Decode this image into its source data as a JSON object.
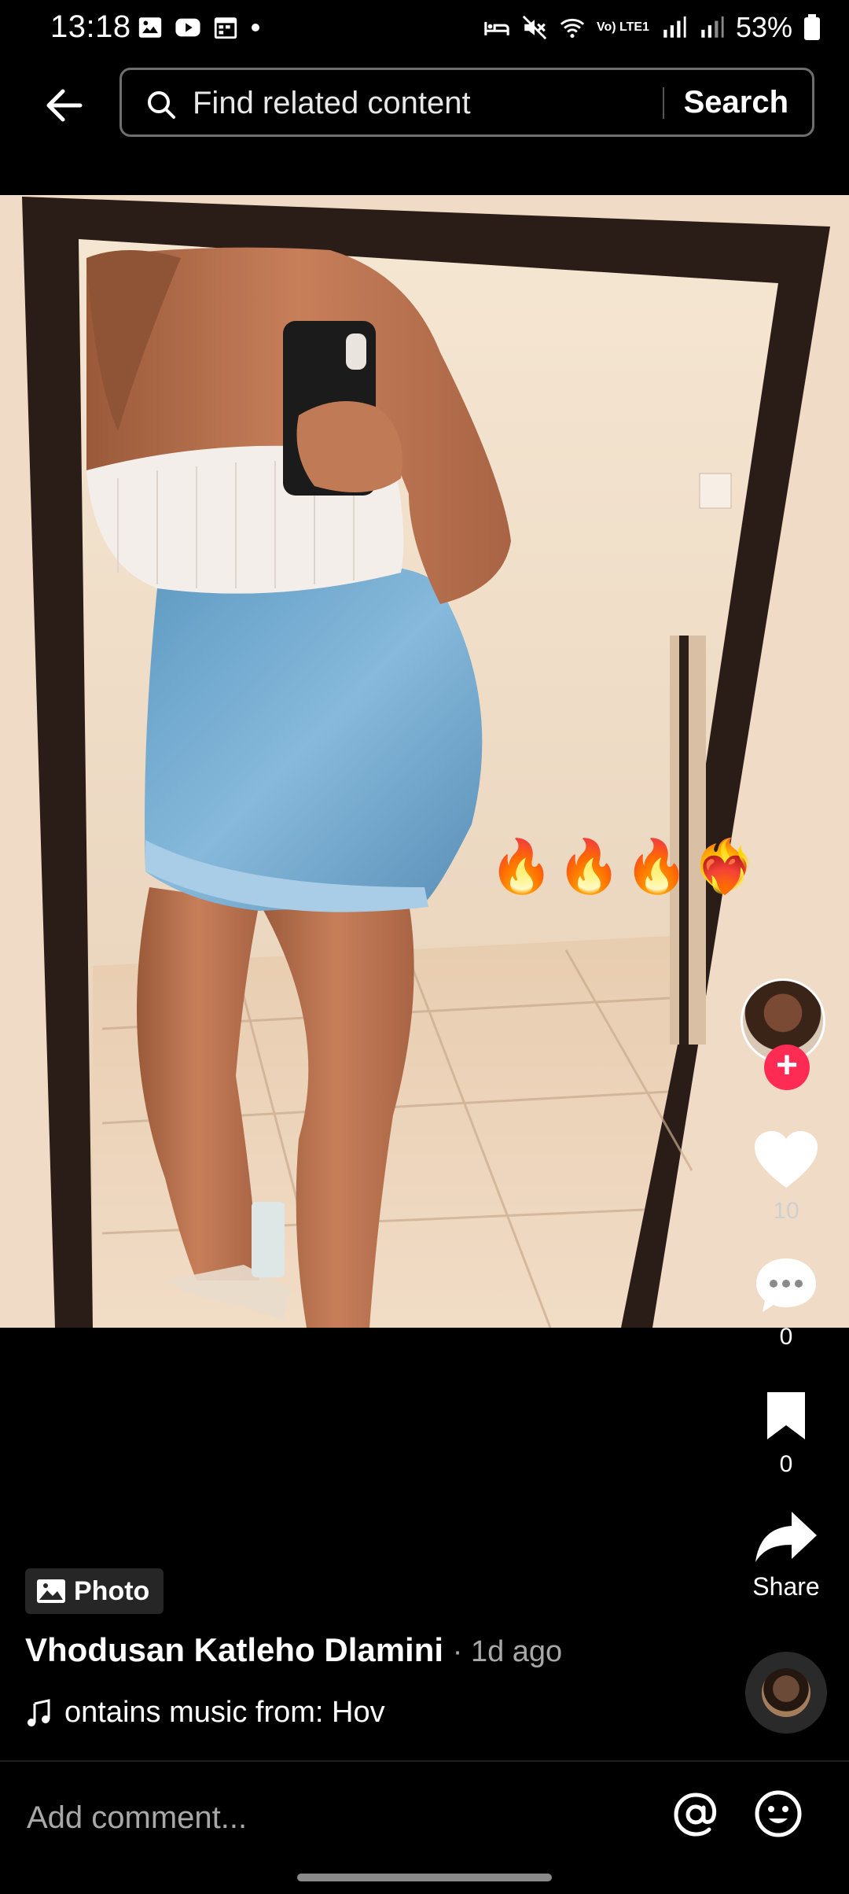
{
  "status_bar": {
    "time": "13:18",
    "battery": "53%",
    "network_label": "Vo) LTE1"
  },
  "search": {
    "placeholder": "Find related content",
    "button_label": "Search"
  },
  "photo": {
    "overlay_emojis": "🔥🔥🔥❤️‍🔥"
  },
  "rail": {
    "like_count": "10",
    "comment_count": "0",
    "bookmark_count": "0",
    "share_label": "Share"
  },
  "post": {
    "badge_label": "Photo",
    "author": "Vhodusan Katleho Dlamini",
    "time": "· 1d ago",
    "music": "ontains music from: Hov"
  },
  "comment": {
    "placeholder": "Add comment..."
  },
  "colors": {
    "accent": "#fe2c55",
    "background": "#000000"
  }
}
